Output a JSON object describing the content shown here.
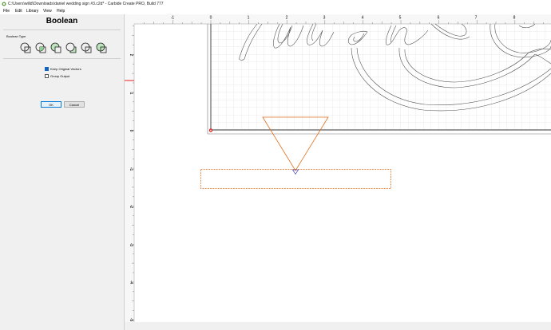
{
  "window": {
    "title": "C:\\Users\\willd\\Downloads\\daniel wedding sign #3.c2d* - Carbide Create PRO, Build 777"
  },
  "menu": [
    {
      "label": "File"
    },
    {
      "label": "Edit"
    },
    {
      "label": "Library"
    },
    {
      "label": "View"
    },
    {
      "label": "Help"
    }
  ],
  "panel": {
    "title": "Boolean",
    "boolean_type_label": "Boolean Type",
    "operations": [
      {
        "icon": "union-icon"
      },
      {
        "icon": "intersect-icon"
      },
      {
        "icon": "subtract-icon"
      },
      {
        "icon": "subtract-reverse-icon"
      },
      {
        "icon": "exclude-icon"
      },
      {
        "icon": "split-icon"
      }
    ],
    "keep_original_vectors": {
      "label": "Keep Original Vectors",
      "checked": true
    },
    "group_output": {
      "label": "Group Output",
      "checked": false
    },
    "ok_label": "OK",
    "cancel_label": "Cancel"
  },
  "ruler": {
    "x_labels": [
      "-1",
      "0",
      "1",
      "2",
      "3",
      "4",
      "5",
      "6",
      "7",
      "8"
    ],
    "y_labels": [
      "2",
      "1",
      "0",
      "-1",
      "-2",
      "-3",
      "-4",
      "-5"
    ]
  },
  "colors": {
    "selection": "#e07020",
    "vector": "#555555",
    "node": "#1a1ab0",
    "origin": "#e02020",
    "checkbox_checked": "#1565c0"
  }
}
